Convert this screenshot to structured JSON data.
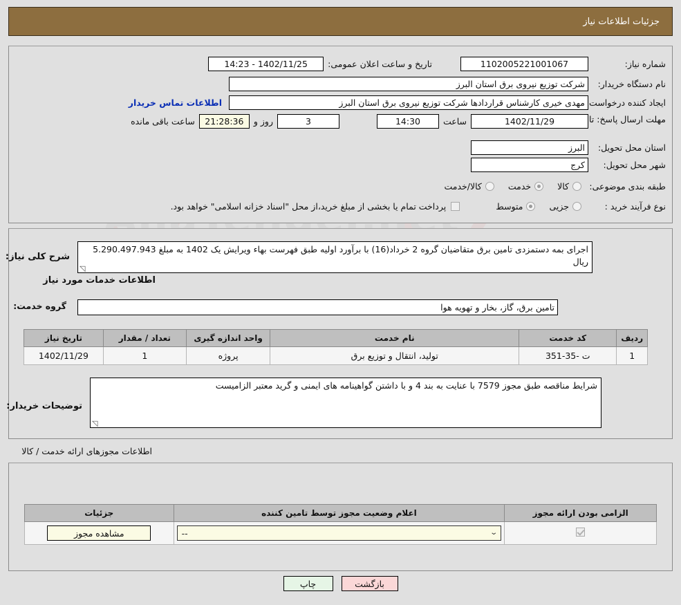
{
  "header": {
    "title": "جزئیات اطلاعات نیاز"
  },
  "need": {
    "number_label": "شماره نیاز:",
    "number_value": "1102005221001067",
    "announce_label": "تاریخ و ساعت اعلان عمومی:",
    "announce_value": "1402/11/25 - 14:23",
    "buyer_org_label": "نام دستگاه خریدار:",
    "buyer_org_value": "شرکت توزیع نیروی برق استان البرز",
    "creator_label": "ایجاد کننده درخواست:",
    "creator_value": "مهدی خیری کارشناس قراردادها شرکت توزیع نیروی برق استان البرز",
    "contact_link": "اطلاعات تماس خریدار",
    "deadline_label": "مهلت ارسال پاسخ: تا تاریخ:",
    "deadline_date": "1402/11/29",
    "hour_label": "ساعت",
    "deadline_time": "14:30",
    "days_value": "3",
    "days_label": "روز و",
    "countdown_value": "21:28:36",
    "remaining_label": "ساعت باقی مانده",
    "province_label": "استان محل تحویل:",
    "province_value": "البرز",
    "city_label": "شهر محل تحویل:",
    "city_value": "کرج",
    "category_label": "طبقه بندی موضوعی:",
    "category_options": [
      {
        "label": "کالا",
        "selected": false
      },
      {
        "label": "خدمت",
        "selected": true
      },
      {
        "label": "کالا/خدمت",
        "selected": false
      }
    ],
    "process_label": "نوع فرآیند خرید :",
    "process_options": [
      {
        "label": "جزیی",
        "selected": false
      },
      {
        "label": "متوسط",
        "selected": true
      }
    ],
    "treasury_checked": false,
    "treasury_note": "پرداخت تمام یا بخشی از مبلغ خرید،از محل \"اسناد خزانه اسلامی\" خواهد بود."
  },
  "description": {
    "label": "شرح کلی نیاز:",
    "value": "اجرای بمه دستمزدی تامین برق متقاضیان گروه 2 خرداد(16) با برآورد اولیه طبق فهرست بهاء ویرایش یک 1402 به مبلغ 5.290.497.943 ریال"
  },
  "services": {
    "section_title": "اطلاعات خدمات مورد نیاز",
    "group_label": "گروه خدمت:",
    "group_value": "تامین برق، گاز، بخار و تهویه هوا",
    "columns": [
      "ردیف",
      "کد خدمت",
      "نام خدمت",
      "واحد اندازه گیری",
      "تعداد / مقدار",
      "تاریخ نیاز"
    ],
    "rows": [
      {
        "index": "1",
        "code": "ت -35-351",
        "name": "تولید، انتقال و توزیع برق",
        "unit": "پروژه",
        "quantity": "1",
        "date": "1402/11/29"
      }
    ]
  },
  "buyer_notes": {
    "label": "توضیحات خریدار:",
    "value": "شرایط مناقصه طبق مجوز 7579 با عنایت به بند 4 و با داشتن گواهینامه های ایمنی و گرید معتبر الزامیست"
  },
  "licenses": {
    "section_title": "اطلاعات مجوزهای ارائه خدمت / کالا",
    "columns": [
      "الزامی بودن ارائه مجوز",
      "اعلام وضعیت مجوز توسط تامین کننده",
      "جزئیات"
    ],
    "rows": [
      {
        "required_checked": true,
        "status_value": "--",
        "detail_button": "مشاهده مجوز"
      }
    ]
  },
  "footer": {
    "print_label": "چاپ",
    "back_label": "بازگشت"
  },
  "watermark": {
    "text": "AnaTender.net"
  },
  "colors": {
    "header_bg": "#8d6e3f",
    "page_bg": "#e0e0e0",
    "link": "#0b2fb5",
    "print_btn": "#e6f5e6",
    "back_btn": "#fbd7d7",
    "highlight": "#fbfbe4"
  }
}
